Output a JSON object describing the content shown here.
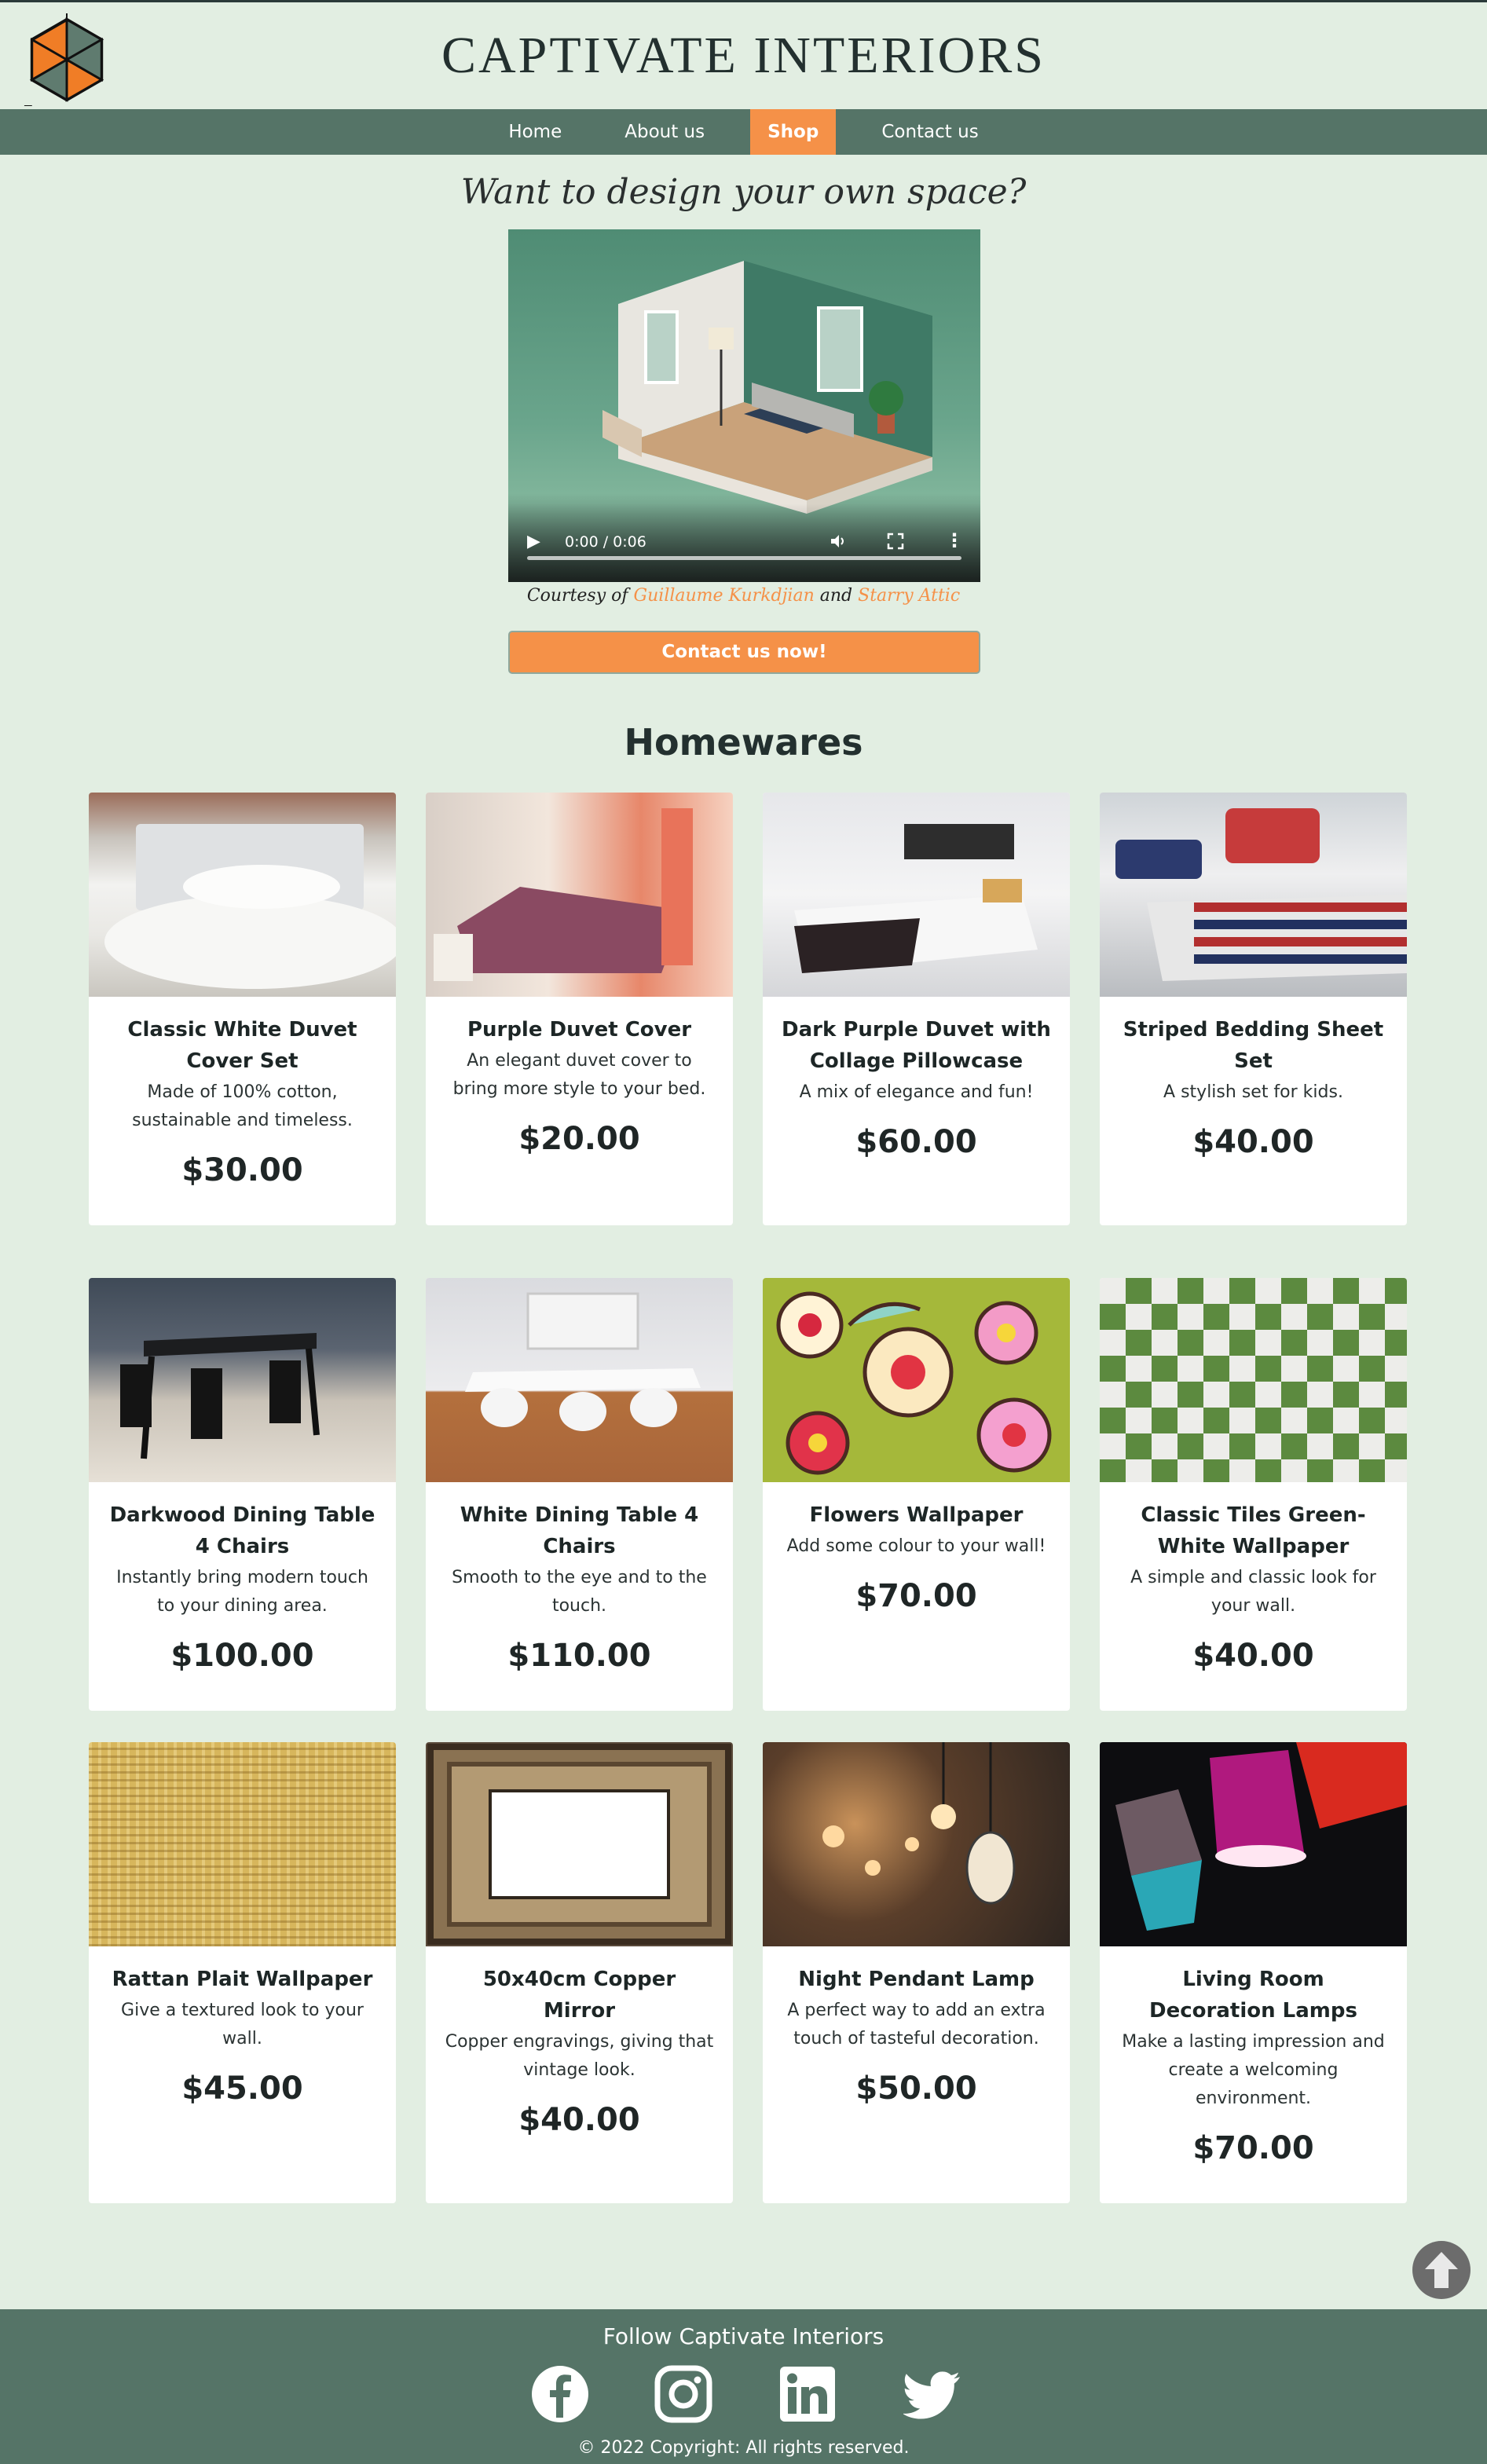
{
  "header": {
    "title": "CAPTIVATE INTERIORS",
    "logo_icon": "hexagon-logo-icon"
  },
  "nav": {
    "items": [
      {
        "label": "Home"
      },
      {
        "label": "About us"
      },
      {
        "label": "Shop",
        "active": true
      },
      {
        "label": "Contact us"
      }
    ]
  },
  "hero": {
    "heading": "Want to design your own space?",
    "video": {
      "time": "0:00 / 0:06",
      "progress": 0
    },
    "courtesy_prefix": "Courtesy of",
    "courtesy_link1": "Guillaume Kurkdjian",
    "courtesy_and": "and",
    "courtesy_link2": "Starry Attic",
    "contact_button": "Contact us now!"
  },
  "homewares": {
    "title": "Homewares",
    "products": [
      {
        "name": "Classic White Duvet Cover Set",
        "desc": "Made of 100% cotton, sustainable and timeless.",
        "price": "$30.00"
      },
      {
        "name": "Purple Duvet Cover",
        "desc": "An elegant duvet cover to bring more style to your bed.",
        "price": "$20.00"
      },
      {
        "name": "Dark Purple Duvet with Collage Pillowcase",
        "desc": "A mix of elegance and fun!",
        "price": "$60.00"
      },
      {
        "name": "Striped Bedding Sheet Set",
        "desc": "A stylish set for kids.",
        "price": "$40.00"
      },
      {
        "name": "Darkwood Dining Table 4 Chairs",
        "desc": "Instantly bring modern touch to your dining area.",
        "price": "$100.00"
      },
      {
        "name": "White Dining Table 4 Chairs",
        "desc": "Smooth to the eye and to the touch.",
        "price": "$110.00"
      },
      {
        "name": "Flowers Wallpaper",
        "desc": "Add some colour to your wall!",
        "price": "$70.00"
      },
      {
        "name": "Classic Tiles Green-White Wallpaper",
        "desc": "A simple and classic look for your wall.",
        "price": "$40.00"
      },
      {
        "name": "Rattan Plait Wallpaper",
        "desc": "Give a textured look to your wall.",
        "price": "$45.00"
      },
      {
        "name": "50x40cm Copper Mirror",
        "desc": "Copper engravings, giving that vintage look.",
        "price": "$40.00"
      },
      {
        "name": "Night Pendant Lamp",
        "desc": "A perfect way to add an extra touch of tasteful decoration.",
        "price": "$50.00"
      },
      {
        "name": "Living Room Decoration Lamps",
        "desc": "Make a lasting impression and create a welcoming environment.",
        "price": "$70.00"
      }
    ]
  },
  "footer": {
    "follow": "Follow Captivate Interiors",
    "social_icons": [
      "facebook-icon",
      "instagram-icon",
      "linkedin-icon",
      "twitter-icon"
    ],
    "copyright": "© 2022 Copyright: All rights reserved."
  },
  "colors": {
    "accent": "#f59148",
    "nav_bg": "#557467",
    "page_bg": "#e2eee2"
  }
}
